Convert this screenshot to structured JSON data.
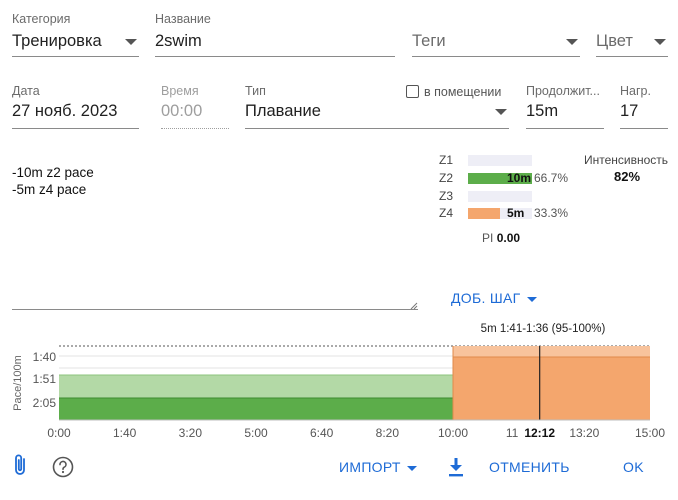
{
  "form": {
    "category": {
      "label": "Категория",
      "value": "Тренировка"
    },
    "name": {
      "label": "Название",
      "value": "2swim"
    },
    "tags": {
      "label": "Теги"
    },
    "color": {
      "label": "Цвет"
    },
    "date": {
      "label": "Дата",
      "value": "27 нояб. 2023"
    },
    "time": {
      "label": "Время",
      "value": "00:00"
    },
    "type": {
      "label": "Тип",
      "value": "Плавание"
    },
    "indoor": {
      "label": "в помещении",
      "checked": false
    },
    "duration": {
      "label": "Продолжит...",
      "value": "15m"
    },
    "load": {
      "label": "Нагр.",
      "value": "17"
    }
  },
  "notes": [
    "-10m z2 pace",
    "-5m z4 pace"
  ],
  "zones": [
    {
      "name": "Z1",
      "time": "",
      "percent": "",
      "fraction": 0
    },
    {
      "name": "Z2",
      "time": "10m",
      "percent": "66.7%",
      "fraction": 1.0,
      "color": "#5cad4a"
    },
    {
      "name": "Z3",
      "time": "",
      "percent": "",
      "fraction": 0
    },
    {
      "name": "Z4",
      "time": "5m",
      "percent": "33.3%",
      "fraction": 0.5,
      "color": "#f4a66d"
    }
  ],
  "pi": {
    "label": "PI",
    "value": "0.00"
  },
  "intensity": {
    "label": "Интенсивность",
    "value": "82%"
  },
  "add_step": "ДОБ. ШАГ",
  "chart_data": {
    "type": "area",
    "title": "5m 1:41-1:36 (95-100%)",
    "ylabel": "Pace/100m",
    "xlim": [
      0,
      900
    ],
    "y_ticks": [
      "1:40",
      "1:51",
      "2:05"
    ],
    "x_ticks": [
      {
        "t": 0,
        "label": "0:00"
      },
      {
        "t": 100,
        "label": "1:40"
      },
      {
        "t": 200,
        "label": "3:20"
      },
      {
        "t": 300,
        "label": "5:00"
      },
      {
        "t": 400,
        "label": "6:40"
      },
      {
        "t": 500,
        "label": "8:20"
      },
      {
        "t": 600,
        "label": "10:00"
      },
      {
        "t": 690,
        "label": "11"
      },
      {
        "t": 732,
        "label": "12:12"
      },
      {
        "t": 800,
        "label": "13:20"
      },
      {
        "t": 900,
        "label": "15:00"
      }
    ],
    "cursor": {
      "t": 732,
      "label": "12:12"
    },
    "steps": [
      {
        "start": 0,
        "end": 600,
        "zone": "Z2",
        "color": "#5cad4a",
        "band_color": "#b3d9a6"
      },
      {
        "start": 600,
        "end": 900,
        "zone": "Z4",
        "color": "#f4a66d",
        "band_color": "#f8c39c"
      }
    ],
    "grid": true
  },
  "toolbar": {
    "import": "ИМПОРТ",
    "cancel": "ОТМЕНИТЬ",
    "ok": "OK"
  },
  "icons": {
    "attach": "paperclip-icon",
    "help": "help-icon",
    "download": "download-icon"
  },
  "colors": {
    "accent": "#1e6bd6",
    "zone2": "#5cad4a",
    "zone4": "#f4a66d"
  }
}
